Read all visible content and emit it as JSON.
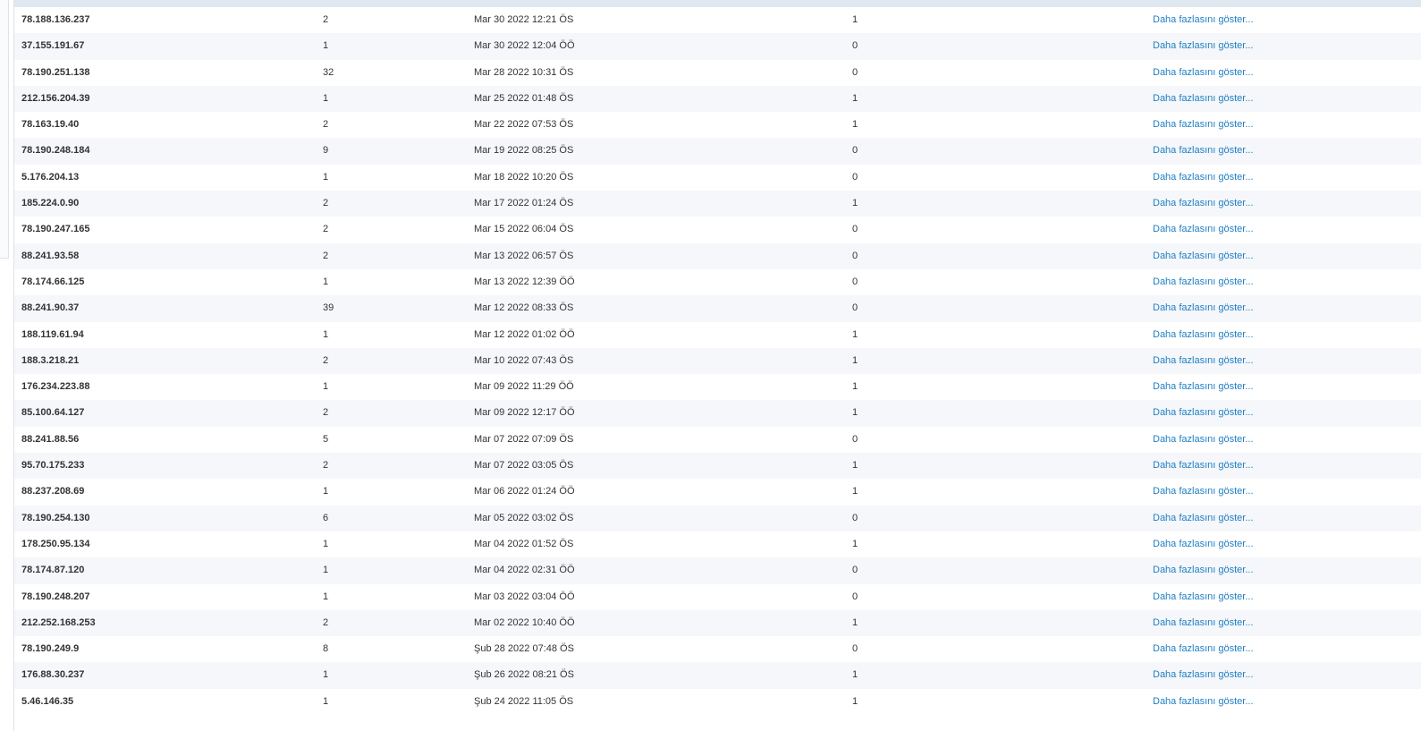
{
  "colors": {
    "link": "#1f7fc4",
    "row_alt": "#f5f7fa",
    "header_strip": "#dfe8f0"
  },
  "rows": [
    {
      "ip": "78.188.136.237",
      "count": "2",
      "date": "Mar 30 2022 12:21 ÖS",
      "flag": "1",
      "link": "Daha fazlasını göster..."
    },
    {
      "ip": "37.155.191.67",
      "count": "1",
      "date": "Mar 30 2022 12:04 ÖÖ",
      "flag": "0",
      "link": "Daha fazlasını göster..."
    },
    {
      "ip": "78.190.251.138",
      "count": "32",
      "date": "Mar 28 2022 10:31 ÖS",
      "flag": "0",
      "link": "Daha fazlasını göster..."
    },
    {
      "ip": "212.156.204.39",
      "count": "1",
      "date": "Mar 25 2022 01:48 ÖS",
      "flag": "1",
      "link": "Daha fazlasını göster..."
    },
    {
      "ip": "78.163.19.40",
      "count": "2",
      "date": "Mar 22 2022 07:53 ÖS",
      "flag": "1",
      "link": "Daha fazlasını göster..."
    },
    {
      "ip": "78.190.248.184",
      "count": "9",
      "date": "Mar 19 2022 08:25 ÖS",
      "flag": "0",
      "link": "Daha fazlasını göster..."
    },
    {
      "ip": "5.176.204.13",
      "count": "1",
      "date": "Mar 18 2022 10:20 ÖS",
      "flag": "0",
      "link": "Daha fazlasını göster..."
    },
    {
      "ip": "185.224.0.90",
      "count": "2",
      "date": "Mar 17 2022 01:24 ÖS",
      "flag": "1",
      "link": "Daha fazlasını göster..."
    },
    {
      "ip": "78.190.247.165",
      "count": "2",
      "date": "Mar 15 2022 06:04 ÖS",
      "flag": "0",
      "link": "Daha fazlasını göster..."
    },
    {
      "ip": "88.241.93.58",
      "count": "2",
      "date": "Mar 13 2022 06:57 ÖS",
      "flag": "0",
      "link": "Daha fazlasını göster..."
    },
    {
      "ip": "78.174.66.125",
      "count": "1",
      "date": "Mar 13 2022 12:39 ÖÖ",
      "flag": "0",
      "link": "Daha fazlasını göster..."
    },
    {
      "ip": "88.241.90.37",
      "count": "39",
      "date": "Mar 12 2022 08:33 ÖS",
      "flag": "0",
      "link": "Daha fazlasını göster..."
    },
    {
      "ip": "188.119.61.94",
      "count": "1",
      "date": "Mar 12 2022 01:02 ÖÖ",
      "flag": "1",
      "link": "Daha fazlasını göster..."
    },
    {
      "ip": "188.3.218.21",
      "count": "2",
      "date": "Mar 10 2022 07:43 ÖS",
      "flag": "1",
      "link": "Daha fazlasını göster..."
    },
    {
      "ip": "176.234.223.88",
      "count": "1",
      "date": "Mar 09 2022 11:29 ÖÖ",
      "flag": "1",
      "link": "Daha fazlasını göster..."
    },
    {
      "ip": "85.100.64.127",
      "count": "2",
      "date": "Mar 09 2022 12:17 ÖÖ",
      "flag": "1",
      "link": "Daha fazlasını göster..."
    },
    {
      "ip": "88.241.88.56",
      "count": "5",
      "date": "Mar 07 2022 07:09 ÖS",
      "flag": "0",
      "link": "Daha fazlasını göster..."
    },
    {
      "ip": "95.70.175.233",
      "count": "2",
      "date": "Mar 07 2022 03:05 ÖS",
      "flag": "1",
      "link": "Daha fazlasını göster..."
    },
    {
      "ip": "88.237.208.69",
      "count": "1",
      "date": "Mar 06 2022 01:24 ÖÖ",
      "flag": "1",
      "link": "Daha fazlasını göster..."
    },
    {
      "ip": "78.190.254.130",
      "count": "6",
      "date": "Mar 05 2022 03:02 ÖS",
      "flag": "0",
      "link": "Daha fazlasını göster..."
    },
    {
      "ip": "178.250.95.134",
      "count": "1",
      "date": "Mar 04 2022 01:52 ÖS",
      "flag": "1",
      "link": "Daha fazlasını göster..."
    },
    {
      "ip": "78.174.87.120",
      "count": "1",
      "date": "Mar 04 2022 02:31 ÖÖ",
      "flag": "0",
      "link": "Daha fazlasını göster..."
    },
    {
      "ip": "78.190.248.207",
      "count": "1",
      "date": "Mar 03 2022 03:04 ÖÖ",
      "flag": "0",
      "link": "Daha fazlasını göster..."
    },
    {
      "ip": "212.252.168.253",
      "count": "2",
      "date": "Mar 02 2022 10:40 ÖÖ",
      "flag": "1",
      "link": "Daha fazlasını göster..."
    },
    {
      "ip": "78.190.249.9",
      "count": "8",
      "date": "Şub 28 2022 07:48 ÖS",
      "flag": "0",
      "link": "Daha fazlasını göster..."
    },
    {
      "ip": "176.88.30.237",
      "count": "1",
      "date": "Şub 26 2022 08:21 ÖS",
      "flag": "1",
      "link": "Daha fazlasını göster..."
    },
    {
      "ip": "5.46.146.35",
      "count": "1",
      "date": "Şub 24 2022 11:05 ÖS",
      "flag": "1",
      "link": "Daha fazlasını göster..."
    }
  ]
}
